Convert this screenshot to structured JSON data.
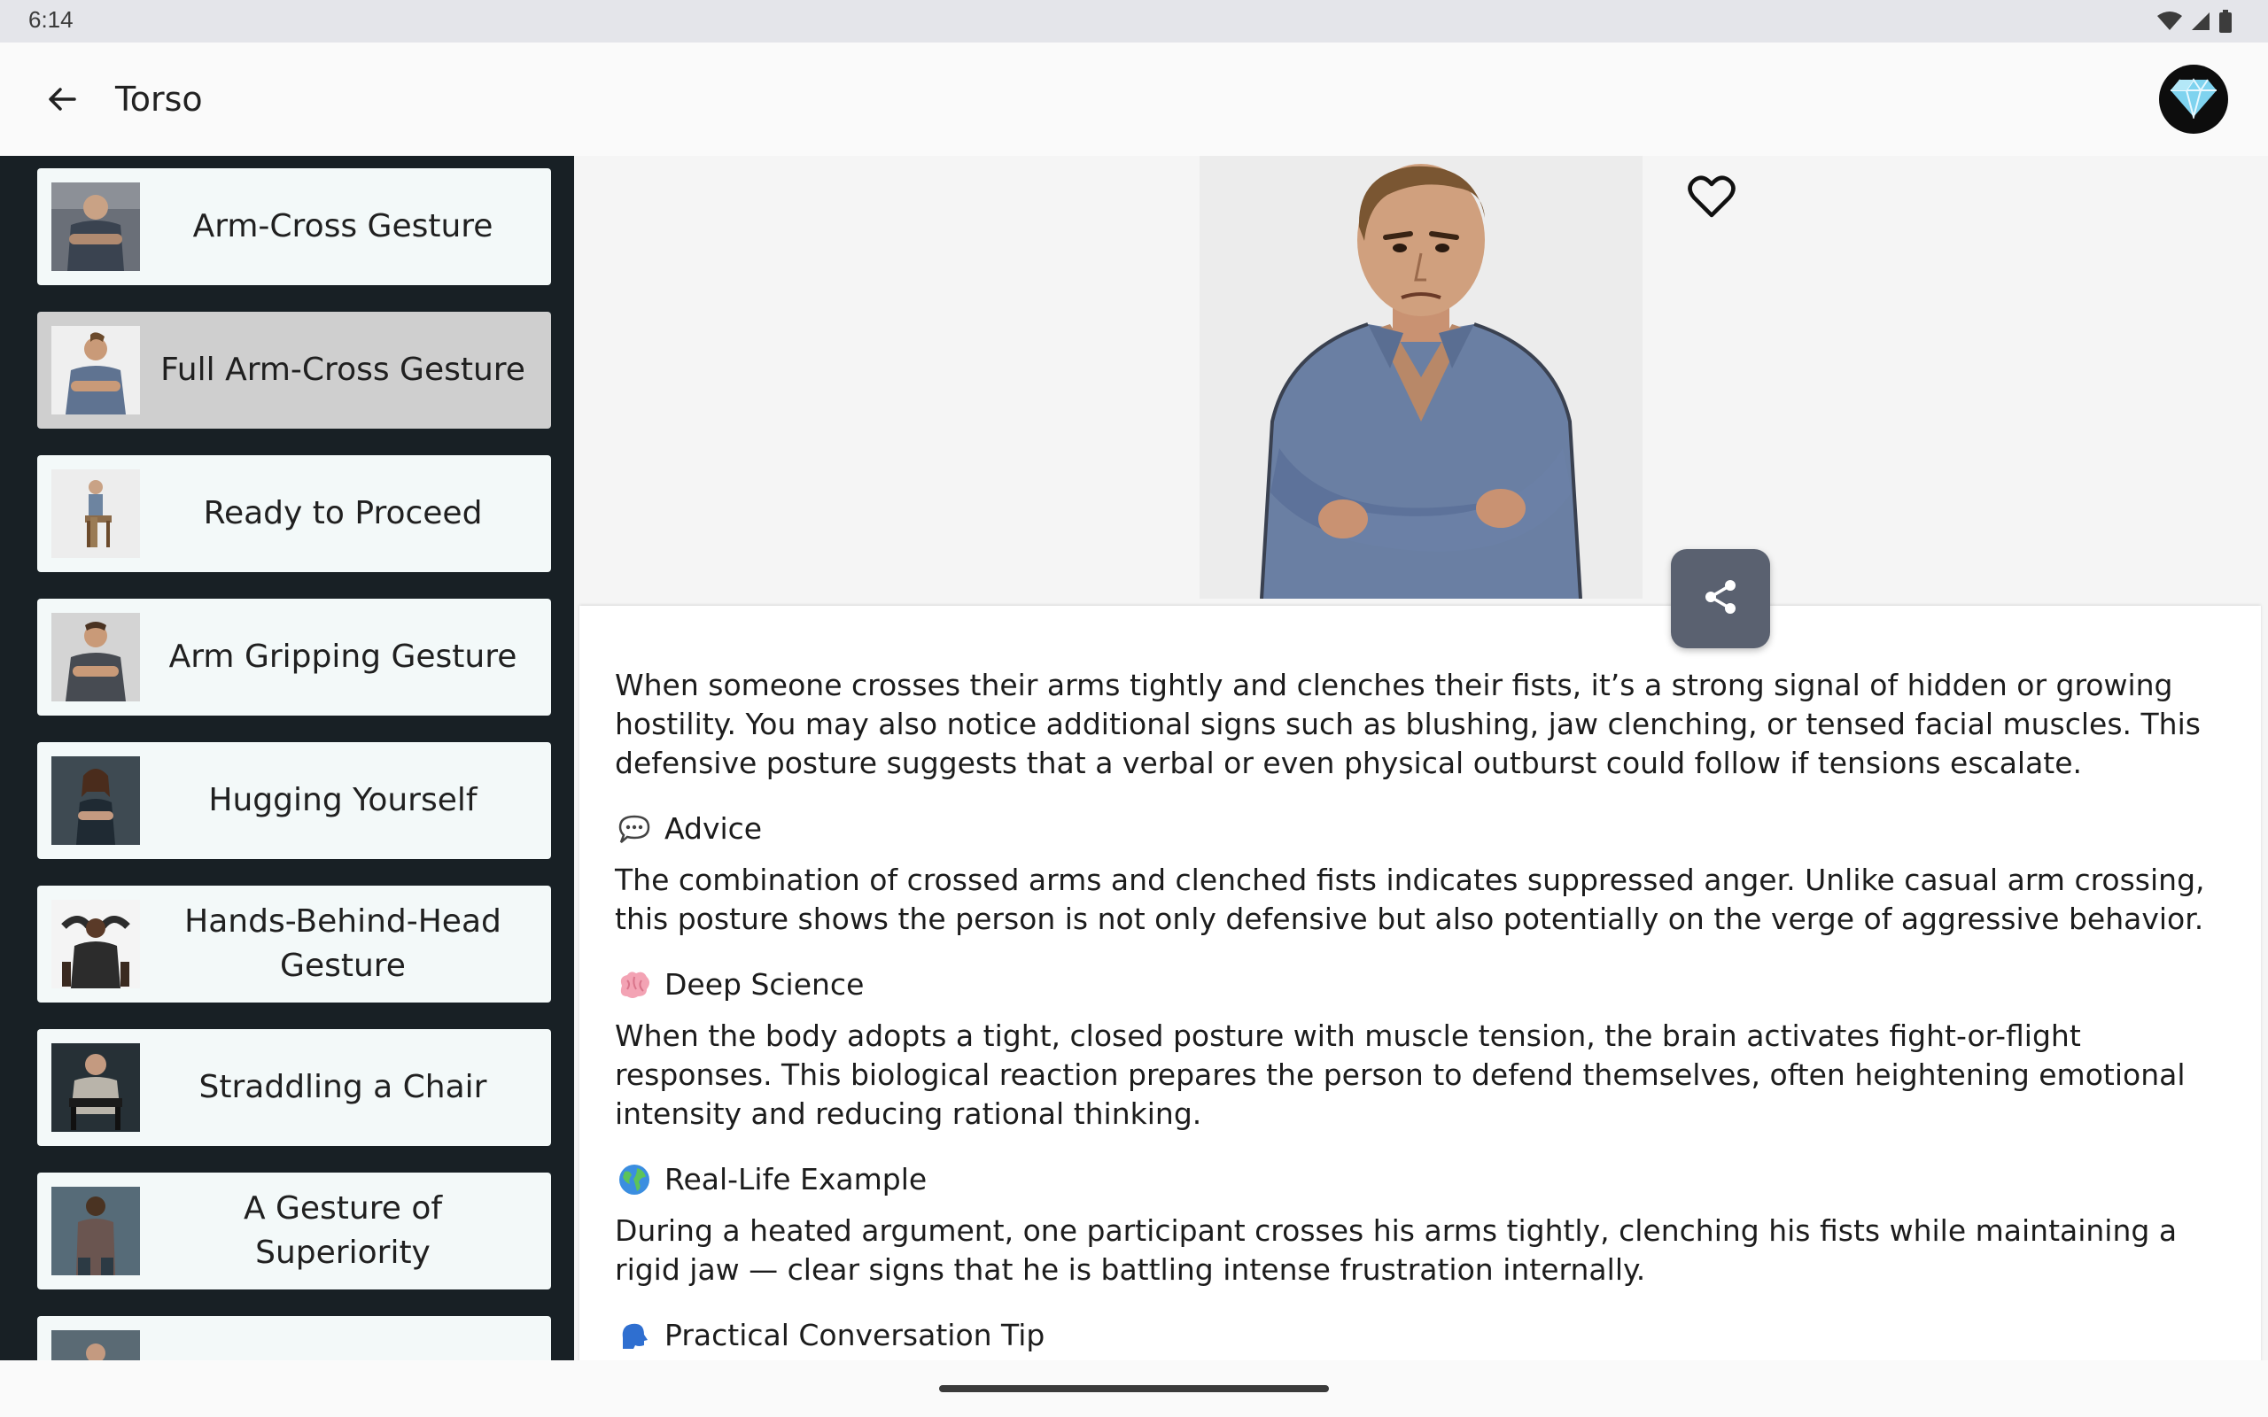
{
  "status_bar": {
    "time": "6:14"
  },
  "app_bar": {
    "title": "Torso"
  },
  "sidebar": {
    "items": [
      {
        "label": "Arm-Cross Gesture",
        "selected": false
      },
      {
        "label": "Full Arm-Cross Gesture",
        "selected": true
      },
      {
        "label": "Ready to Proceed",
        "selected": false
      },
      {
        "label": "Arm Gripping Gesture",
        "selected": false
      },
      {
        "label": "Hugging Yourself",
        "selected": false
      },
      {
        "label": "Hands-Behind-Head Gesture",
        "selected": false
      },
      {
        "label": "Straddling a Chair",
        "selected": false
      },
      {
        "label": "A Gesture of Superiority",
        "selected": false
      },
      {
        "label": "",
        "selected": false
      }
    ]
  },
  "detail": {
    "intro": "When someone crosses their arms tightly and clenches their fists, it’s a strong signal of hidden or growing hostility. You may also notice additional signs such as blushing, jaw clenching, or tensed facial muscles. This defensive posture suggests that a verbal or even physical outburst could follow if tensions escalate.",
    "sections": [
      {
        "icon": "speech-bubble-icon",
        "title": "Advice",
        "text": "The combination of crossed arms and clenched fists indicates suppressed anger. Unlike casual arm crossing, this posture shows the person is not only defensive but also potentially on the verge of aggressive behavior."
      },
      {
        "icon": "brain-icon",
        "title": "Deep Science",
        "text": "When the body adopts a tight, closed posture with muscle tension, the brain activates fight-or-flight responses. This biological reaction prepares the person to defend themselves, often heightening emotional intensity and reducing rational thinking."
      },
      {
        "icon": "globe-icon",
        "title": "Real-Life Example",
        "text": "During a heated argument, one participant crosses his arms tightly, clenching his fists while maintaining a rigid jaw — clear signs that he is battling intense frustration internally."
      },
      {
        "icon": "speaking-head-icon",
        "title": "Practical Conversation Tip",
        "text": ""
      }
    ]
  },
  "colors": {
    "sidebar_bg": "#182025",
    "card_bg": "#f3f9f9",
    "card_selected_bg": "#cfcfcf",
    "share_button_bg": "#5a6170"
  }
}
